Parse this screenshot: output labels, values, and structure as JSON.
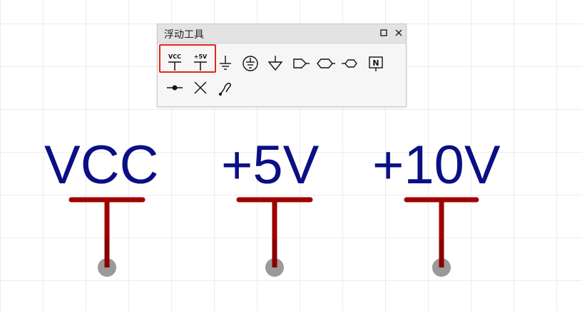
{
  "toolbar_window": {
    "title": "浮动工具",
    "restore_icon": "restore-square-icon",
    "close_icon": "close-x-icon",
    "tools": [
      {
        "name": "vcc-power-tool",
        "label": "VCC"
      },
      {
        "name": "plus5v-power-tool",
        "label": "+5V"
      },
      {
        "name": "ground-tool",
        "label": ""
      },
      {
        "name": "earth-ground-tool",
        "label": ""
      },
      {
        "name": "signal-ground-tool",
        "label": ""
      },
      {
        "name": "net-port-input-tool",
        "label": ""
      },
      {
        "name": "net-port-bidirectional-tool",
        "label": ""
      },
      {
        "name": "net-port-hex-tool",
        "label": ""
      },
      {
        "name": "net-label-tool",
        "label": "N"
      },
      {
        "name": "junction-tool",
        "label": ""
      },
      {
        "name": "no-connect-tool",
        "label": ""
      },
      {
        "name": "probe-tool",
        "label": ""
      }
    ]
  },
  "symbols": [
    {
      "label": "VCC"
    },
    {
      "label": "+5V"
    },
    {
      "label": "+10V"
    }
  ],
  "colors": {
    "label_text": "#0a0f84",
    "symbol_stroke": "#a00000",
    "pin_dot": "#9a9a9a",
    "highlight": "#e0251b"
  }
}
